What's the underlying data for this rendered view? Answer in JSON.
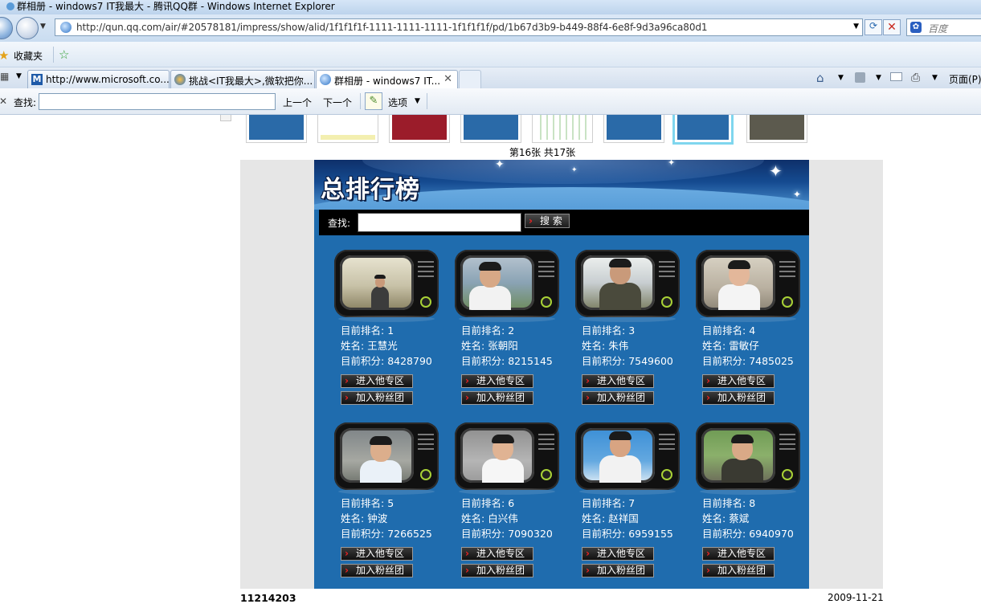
{
  "window": {
    "title": "群相册 - windows7 IT我最大 - 腾讯QQ群 - Windows Internet Explorer"
  },
  "address_bar": {
    "url": "http://qun.qq.com/air/#20578181/impress/show/alid/1f1f1f1f-1111-1111-1111-1f1f1f1f/pd/1b67d3b9-b449-88f4-6e8f-9d3a96ca80d1",
    "search_placeholder": "百度"
  },
  "favorites_bar": {
    "favorites_label": "收藏夹"
  },
  "tabs": [
    {
      "label": "http://www.microsoft.co...",
      "active": false
    },
    {
      "label": "挑战<IT我最大>,微软把你...",
      "active": false
    },
    {
      "label": "群相册 - windows7 IT...",
      "active": true
    }
  ],
  "command_bar": {
    "page_label": "页面(P)"
  },
  "find_bar": {
    "label": "查找:",
    "input_value": "",
    "prev_label": "上一个",
    "next_label": "下一个",
    "options_label": "选项"
  },
  "album": {
    "counter": "第16张 共17张",
    "photo_id": "11214203",
    "date": "2009-11-21"
  },
  "ranking": {
    "title": "总排行榜",
    "search_label": "查找:",
    "search_button": "搜 索",
    "rank_prefix": "目前排名:",
    "name_prefix": "姓名:",
    "score_prefix": "目前积分:",
    "zone_button": "进入他专区",
    "fan_button": "加入粉丝团",
    "entries": [
      {
        "rank": "1",
        "name": "王慧光",
        "score": "8428790"
      },
      {
        "rank": "2",
        "name": "张朝阳",
        "score": "8215145"
      },
      {
        "rank": "3",
        "name": "朱伟",
        "score": "7549600"
      },
      {
        "rank": "4",
        "name": "雷敏仔",
        "score": "7485025"
      },
      {
        "rank": "5",
        "name": "钟波",
        "score": "7266525"
      },
      {
        "rank": "6",
        "name": "白兴伟",
        "score": "7090320"
      },
      {
        "rank": "7",
        "name": "赵祥国",
        "score": "6959155"
      },
      {
        "rank": "8",
        "name": "蔡斌",
        "score": "6940970"
      }
    ]
  },
  "colors": {
    "panel_blue": "#1f6cae",
    "chrome_blue": "#dbe8f6",
    "button_chevron": "#e22222"
  }
}
